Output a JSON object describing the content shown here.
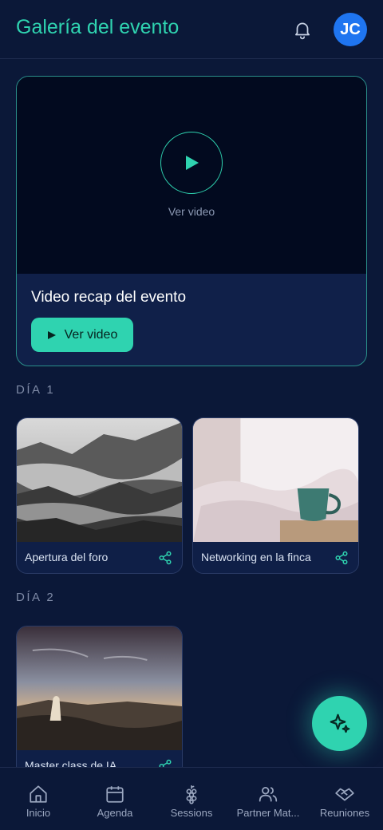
{
  "header": {
    "title": "Galería del evento",
    "avatar_initials": "JC"
  },
  "hero": {
    "video_caption": "Ver video",
    "title": "Video recap del evento",
    "button_label": "Ver video"
  },
  "days": [
    {
      "label": "DÍA 1",
      "photos": [
        {
          "caption": "Apertura del foro"
        },
        {
          "caption": "Networking en la finca"
        }
      ]
    },
    {
      "label": "DÍA 2",
      "photos": [
        {
          "caption": "Master class de IA"
        }
      ]
    }
  ],
  "bottom_nav": [
    {
      "label": "Inicio",
      "icon": "home-icon"
    },
    {
      "label": "Agenda",
      "icon": "calendar-icon"
    },
    {
      "label": "Sessions",
      "icon": "grapes-icon"
    },
    {
      "label": "Partner Mat...",
      "icon": "people-icon"
    },
    {
      "label": "Reuniones",
      "icon": "handshake-icon"
    }
  ],
  "colors": {
    "accent": "#2fd3b0",
    "background": "#0b1838",
    "avatar": "#1f75f0"
  }
}
